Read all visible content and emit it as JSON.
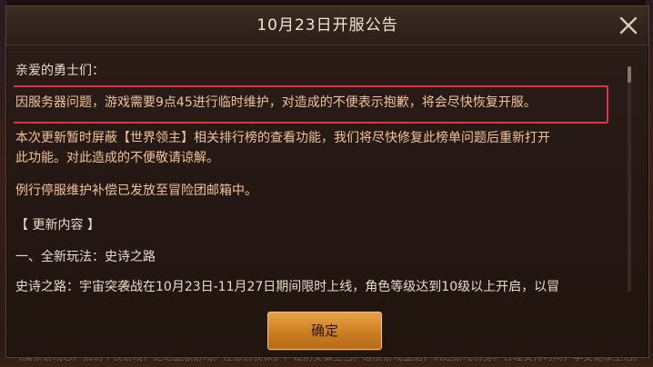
{
  "dialog": {
    "title": "10月23日开服公告",
    "confirm_label": "确定",
    "colors": {
      "accent": "#f0c49a",
      "highlight_border": "#e0304a",
      "button": "#d88a2c"
    }
  },
  "announcement": {
    "greeting": "亲爱的勇士们：",
    "highlight": "因服务器问题，游戏需要9点45进行临时维护，对造成的不便表示抱歉，将会尽快恢复开服。",
    "para1_line1": "本次更新暂时屏蔽【世界领主】相关排行榜的查看功能，我们将尽快修复此榜单问题后重新打开",
    "para1_line2": "此功能。对此造成的不便敬请谅解。",
    "para2": "例行停服维护补偿已发放至冒险团邮箱中。",
    "section_header": "【 更新内容 】",
    "item1": "一、全新玩法：史诗之路",
    "item1_desc": "史诗之路：宇宙突袭战在10月23日-11月27日期间限时上线，角色等级达到10级以上开启，以冒"
  },
  "background": {
    "bottom_text": "《魔禁游戏忘》抵制不良游戏，拒绝盗版游戏。注意自我保护，谨防受骗上当。适度游戏益脑，沉迷游戏伤身。合理安排时间，享受健康生活。"
  }
}
